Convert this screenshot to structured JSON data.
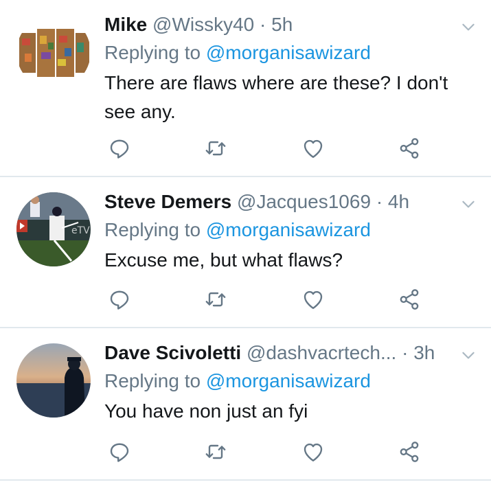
{
  "tweets": [
    {
      "name": "Mike",
      "handle": "@Wissky40",
      "separator": "·",
      "time": "5h",
      "replying_prefix": "Replying to",
      "replying_to": "@morganisawizard",
      "text": "There are flaws where are these? I don't see any."
    },
    {
      "name": "Steve Demers",
      "handle": "@Jacques1069",
      "separator": "·",
      "time": "4h",
      "replying_prefix": "Replying to",
      "replying_to": "@morganisawizard",
      "text": "Excuse me, but what flaws?"
    },
    {
      "name": "Dave Scivoletti",
      "handle": "@dashvacrtech...",
      "separator": "·",
      "time": "3h",
      "replying_prefix": "Replying to",
      "replying_to": "@morganisawizard",
      "text": "You have non just an fyi"
    }
  ],
  "icons": {
    "reply": "reply-icon",
    "retweet": "retweet-icon",
    "like": "heart-icon",
    "share": "share-icon",
    "menu": "chevron-down-icon"
  },
  "colors": {
    "link": "#1b95e0",
    "muted": "#657786",
    "text": "#14171a",
    "divider": "#e1e8ed"
  }
}
